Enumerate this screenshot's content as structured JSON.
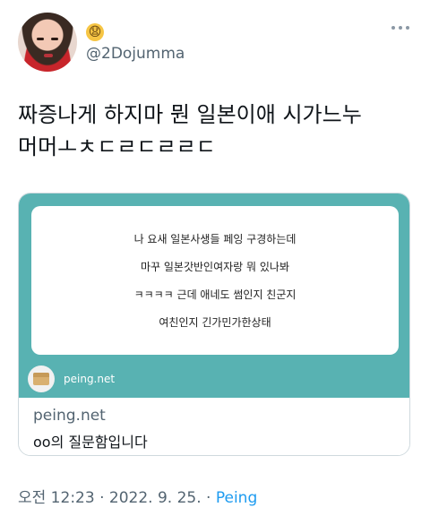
{
  "user": {
    "handle": "@2Dojumma",
    "emoji": "😧"
  },
  "tweet": {
    "text": "짜증나게 하지마 뭔 일본이애 시가느누\n머머ㅗㅊㄷㄹㄷㄹㄹㄷ"
  },
  "card": {
    "image_lines": [
      "나 요새 일본사생들 페잉 구경하는데",
      "마꾸 일본갓반인여자랑 뭐 있나봐",
      "ㅋㅋㅋㅋ 근데 애네도 썸인지 친군지",
      "여친인지 긴가민가한상태"
    ],
    "image_site": "peing.net",
    "domain": "peing.net",
    "title": "oo의 질문함입니다"
  },
  "meta": {
    "time_date": "오전 12:23 · 2022. 9. 25. · ",
    "source": "Peing"
  },
  "colors": {
    "card_teal": "#58b2b2",
    "link_blue": "#1d9bf0",
    "secondary_text": "#536471"
  }
}
